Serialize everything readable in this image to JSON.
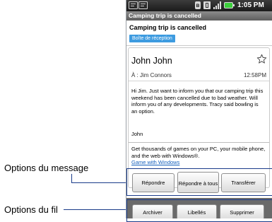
{
  "status_bar": {
    "notification_icons": [
      "mail-notification-icon",
      "mail-notification-icon"
    ],
    "icons": [
      "bluetooth-icon",
      "network-icon",
      "signal-icon",
      "battery-icon"
    ],
    "time": "1:05 PM"
  },
  "title_bar": {
    "title": "Camping trip is cancelled"
  },
  "subject_panel": {
    "subject": "Camping trip is cancelled",
    "label": "Boîte de réception"
  },
  "message": {
    "sender": "John John",
    "to": "À : Jim Connors",
    "time": "12:58PM",
    "starred": false,
    "body": "Hi Jim. Just want to inform you that our camping trip this weekend has been cancelled due to bad weather. Will inform you of any developments. Tracy said bowling is an option.",
    "signature": "John",
    "footer": "Get thousands of games on your PC, your mobile phone, and the web with Windows®.",
    "footer_link": "Game with Windows"
  },
  "message_options": {
    "reply": "Répondre",
    "reply_all": "Répondre à tous",
    "forward": "Transférer"
  },
  "thread_options": {
    "archive": "Archiver",
    "labels": "Libellés",
    "delete": "Supprimer"
  },
  "callouts": {
    "message_options": "Options du message",
    "thread_options": "Options du fil"
  },
  "colors": {
    "accent_blue": "#3d9be0",
    "link": "#1560bd",
    "callout_line": "#1a3b8a",
    "battery": "#3ccf3c"
  }
}
